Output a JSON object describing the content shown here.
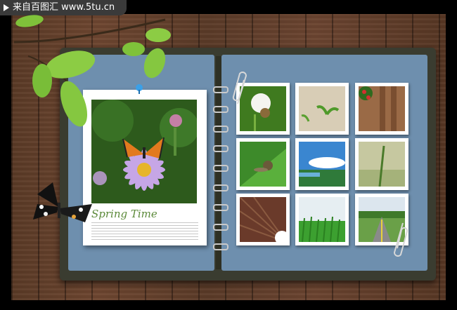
{
  "watermark": {
    "text": "来自百图汇 www.5tu.cn"
  },
  "album": {
    "caption_title": "Spring Time"
  },
  "colors": {
    "page_blue": "#6e8fae",
    "wood": "#5f3f2a",
    "caption_green": "#5c8a3a"
  },
  "icons": {
    "pin": "pushpin-icon",
    "clip": "paperclip-icon",
    "butterfly": "butterfly-decoration",
    "leaves": "leaf-branch-decoration"
  },
  "thumbnails": [
    "white-flower-snail",
    "seedling-sprouts",
    "red-flowers-fence",
    "snail-on-leaf",
    "sky-and-coast",
    "grass-stalk",
    "tunnel-perspective",
    "green-grass-sky",
    "country-road"
  ]
}
